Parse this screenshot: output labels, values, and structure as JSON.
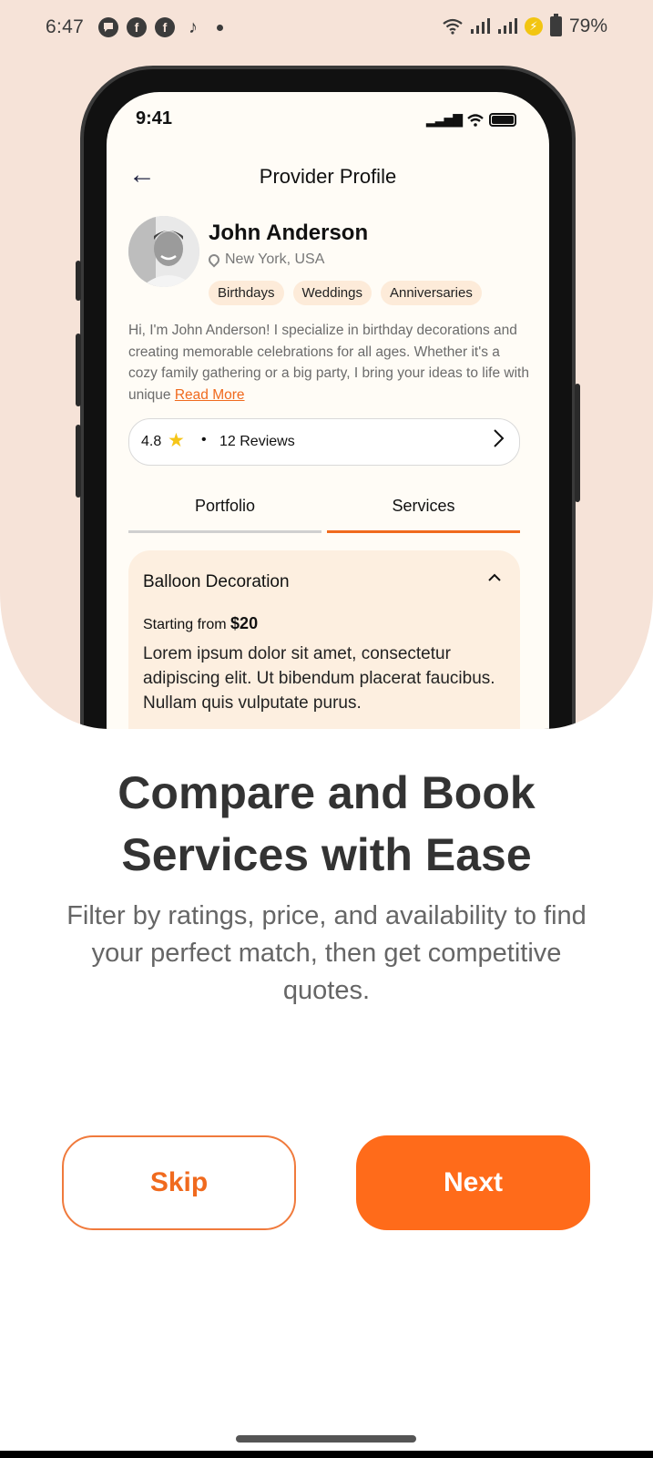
{
  "status_bar": {
    "time": "6:47",
    "battery": "79%",
    "left_icons": [
      "chat-bubble-icon",
      "facebook-icon",
      "facebook-icon",
      "tiktok-icon",
      "dot-icon"
    ],
    "right_icons": [
      "wifi-icon",
      "signal-icon",
      "signal-icon",
      "charging-icon",
      "battery-icon"
    ]
  },
  "phone": {
    "ios_time": "9:41",
    "nav": {
      "title": "Provider Profile"
    },
    "profile": {
      "name": "John Anderson",
      "location": "New York, USA",
      "tags": [
        "Birthdays",
        "Weddings",
        "Anniversaries"
      ],
      "bio": "Hi, I'm John Anderson! I specialize in birthday decorations and creating memorable celebrations for all ages. Whether it's a cozy family gathering or a big party, I bring your ideas to life with unique ",
      "read_more": "Read More"
    },
    "rating": {
      "value": "4.8",
      "separator": "•",
      "reviews": "12 Reviews"
    },
    "tabs": [
      "Portfolio",
      "Services"
    ],
    "active_tab": "Services",
    "service": {
      "title": "Balloon Decoration",
      "starting_label": "Starting from",
      "price": "$20",
      "description": "Lorem ipsum dolor sit amet, consectetur adipiscing elit. Ut bibendum placerat faucibus. Nullam quis vulputate purus."
    }
  },
  "onboarding": {
    "heading_line1": "Compare and Book",
    "heading_line2": "Services with Ease",
    "subtext": "Filter by ratings, price, and availability to find your perfect match, then get competitive quotes.",
    "skip_label": "Skip",
    "next_label": "Next"
  },
  "colors": {
    "accent": "#ff6b1a",
    "hero_bg": "#f6e3d8",
    "tag_bg": "#fdebd9",
    "card_bg": "#fdefe0"
  }
}
